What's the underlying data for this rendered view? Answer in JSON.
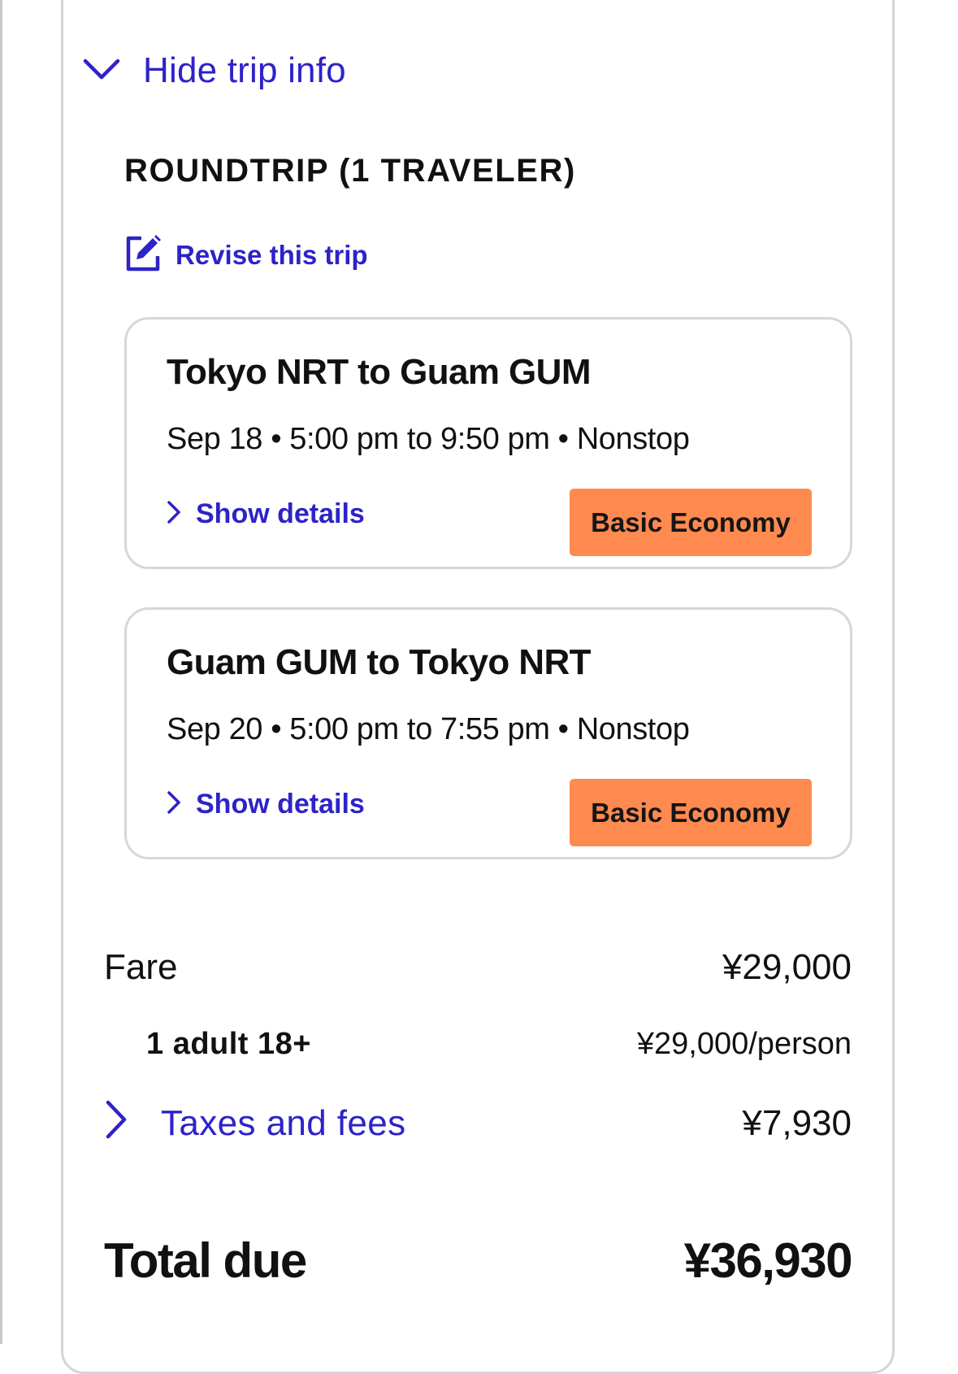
{
  "trip_info": {
    "hide_label": "Hide trip info",
    "section_title": "ROUNDTRIP (1 TRAVELER)",
    "revise_label": "Revise this trip"
  },
  "flights": [
    {
      "route": "Tokyo NRT to Guam GUM",
      "schedule": "Sep 18 • 5:00 pm to 9:50 pm • Nonstop",
      "details_label": "Show details",
      "fare_class": "Basic Economy"
    },
    {
      "route": "Guam GUM to Tokyo NRT",
      "schedule": "Sep 20 • 5:00 pm to 7:55 pm • Nonstop",
      "details_label": "Show details",
      "fare_class": "Basic Economy"
    }
  ],
  "price_summary": {
    "fare_label": "Fare",
    "fare_value": "¥29,000",
    "traveler_label": "1 adult 18+",
    "traveler_value": "¥29,000/person",
    "taxes_label": "Taxes and fees",
    "taxes_value": "¥7,930",
    "total_label": "Total due",
    "total_value": "¥36,930"
  },
  "icons": {
    "hide_trip": "chevron-down-icon",
    "revise": "edit-icon",
    "show_details": "chevron-right-icon",
    "taxes": "chevron-right-icon"
  },
  "colors": {
    "link": "#2d23c8",
    "badge": "#ff8a50",
    "border": "#d4d4d4",
    "text": "#111111"
  }
}
